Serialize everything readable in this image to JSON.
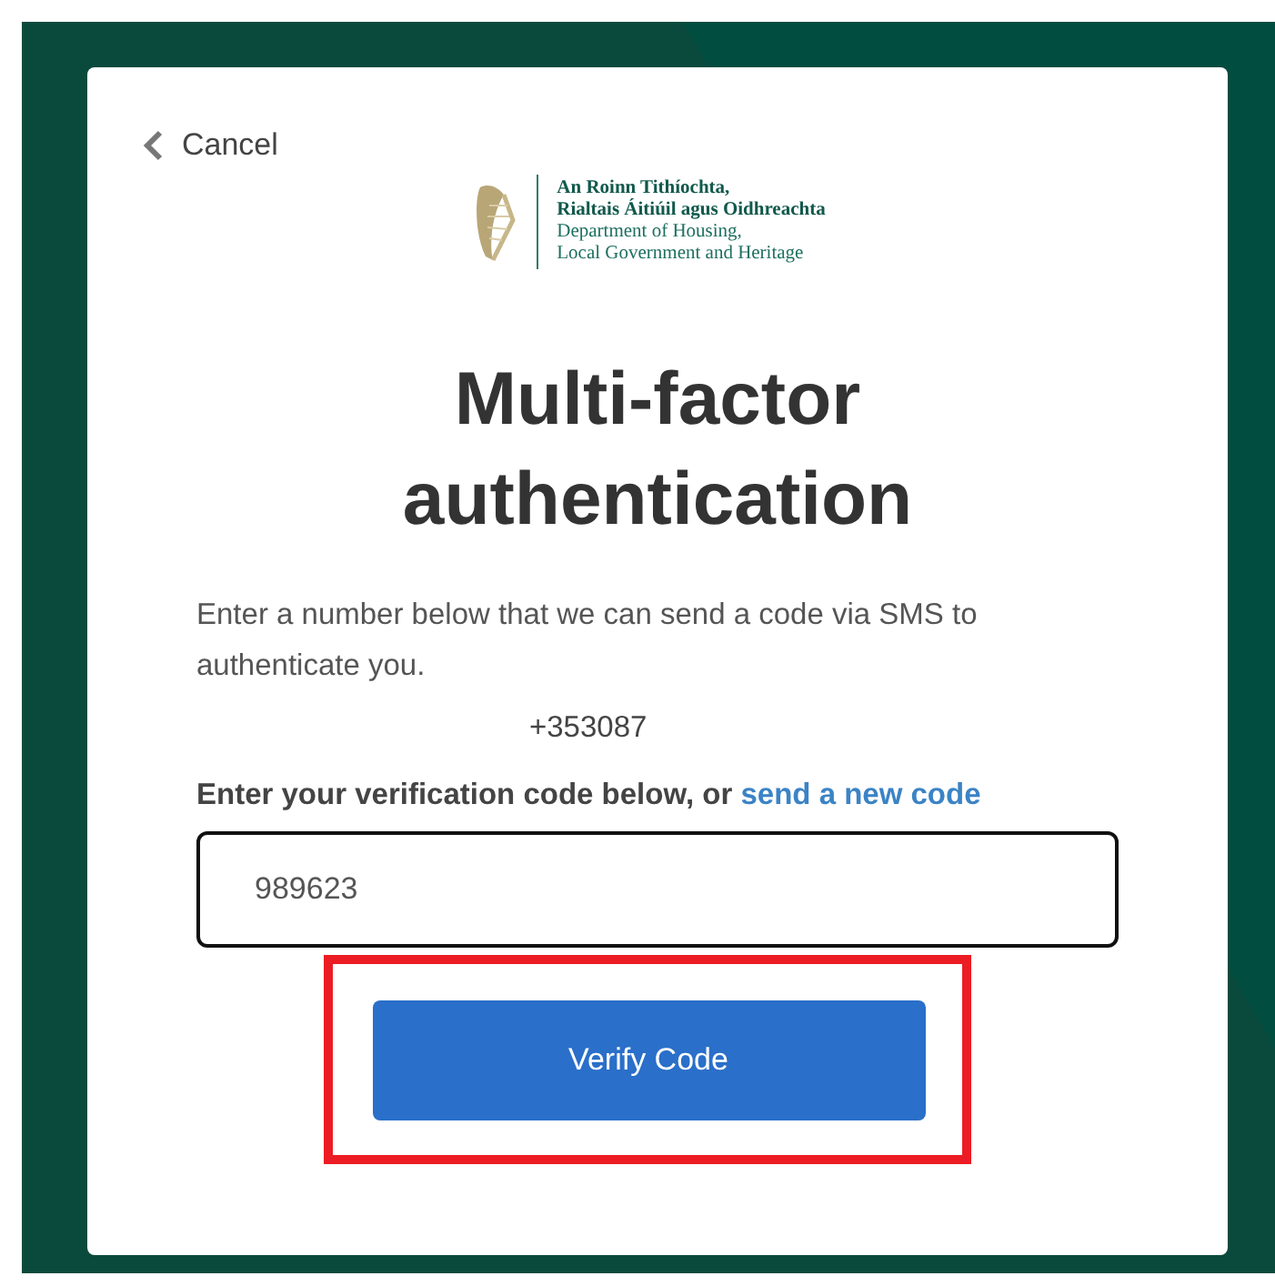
{
  "cancel": {
    "label": "Cancel"
  },
  "logo": {
    "lines": [
      {
        "text": "An Roinn Tithíochta,",
        "bold": true
      },
      {
        "text": "Rialtais Áitiúil agus Oidhreachta",
        "bold": true
      },
      {
        "text": "Department of Housing,",
        "bold": false
      },
      {
        "text": "Local Government and Heritage",
        "bold": false
      }
    ]
  },
  "title": "Multi-factor authentication",
  "description": "Enter a number below that we can send a code via SMS to authenticate you.",
  "phone": "+353087",
  "prompt": {
    "text": "Enter your verification code below, or",
    "link": "send a new code"
  },
  "code_field": {
    "value": "989623"
  },
  "verify_button": {
    "label": "Verify Code",
    "highlighted": true
  }
}
